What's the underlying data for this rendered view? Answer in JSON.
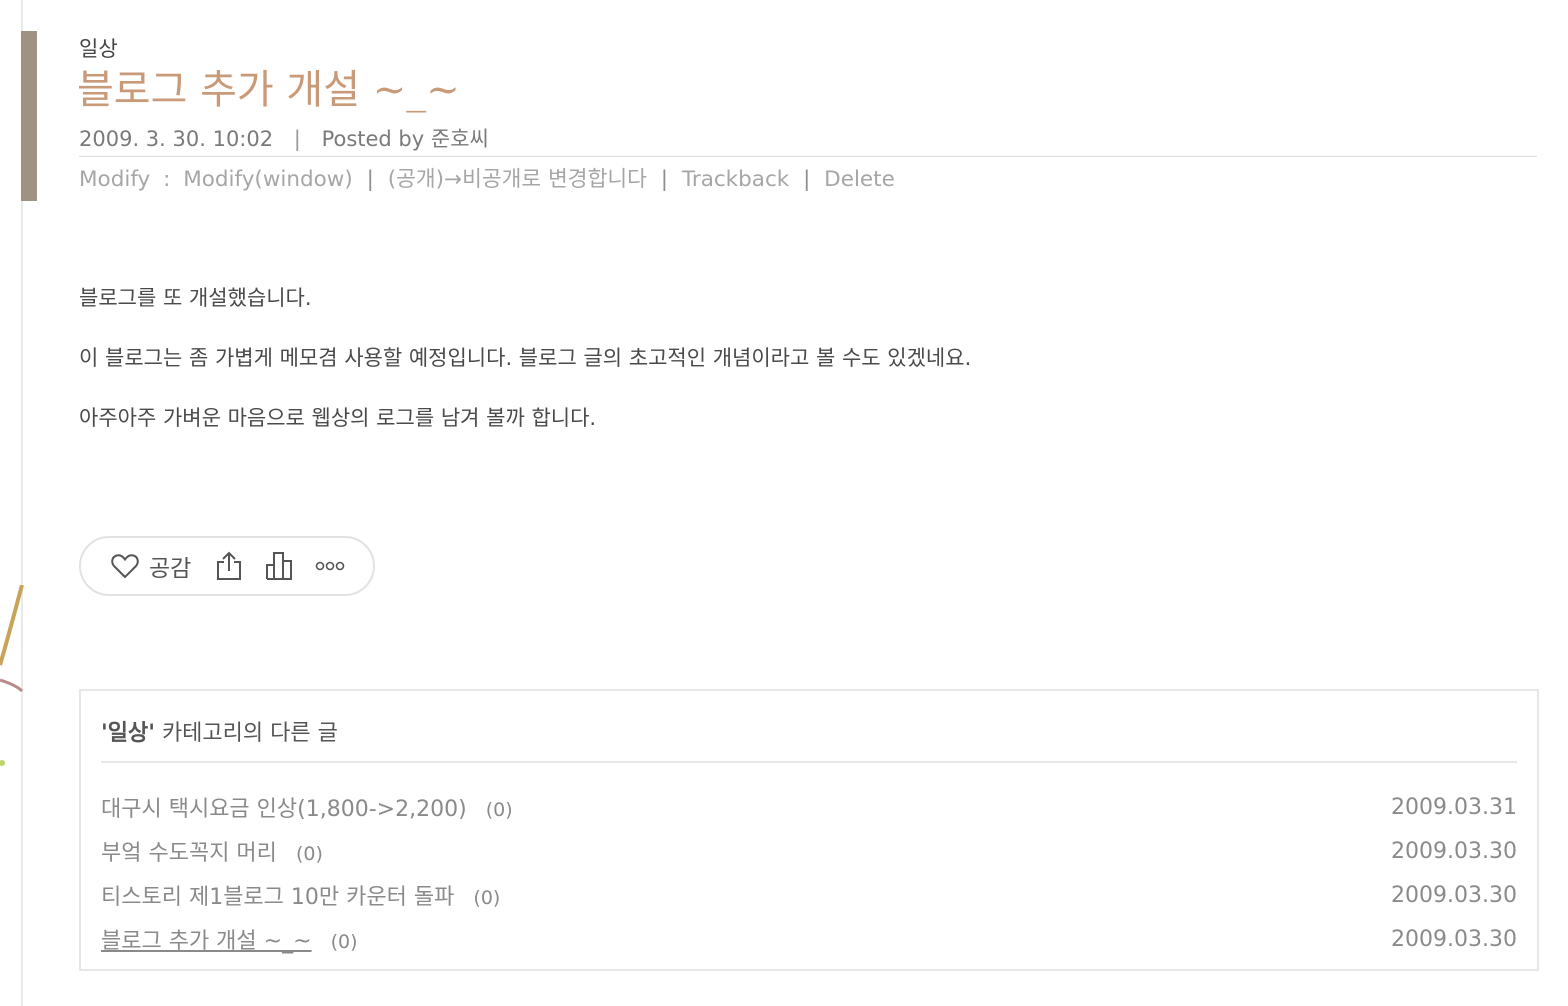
{
  "post": {
    "category": "일상",
    "title": "블로그 추가 개설 ~_~",
    "date": "2009. 3. 30. 10:02",
    "separator": "|",
    "posted_by_label": "Posted by",
    "author": "준호씨",
    "actions": {
      "modify": "Modify",
      "colon": ":",
      "modify_window": "Modify(window)",
      "visibility": "(공개)→비공개로 변경합니다",
      "trackback": "Trackback",
      "delete": "Delete",
      "bar": "|"
    },
    "body": [
      "블로그를 또 개설했습니다.",
      "이 블로그는 좀 가볍게 메모겸 사용할 예정입니다. 블로그 글의 초고적인 개념이라고 볼 수도 있겠네요.",
      "아주아주 가벼운 마음으로 웹상의 로그를 남겨 볼까 합니다."
    ]
  },
  "reactions": {
    "like_label": "공감",
    "icons": [
      "heart-icon",
      "share-icon",
      "stats-icon",
      "more-icon"
    ]
  },
  "related": {
    "title_quoted": "'일상'",
    "title_rest": " 카테고리의 다른 글",
    "items": [
      {
        "title": "대구시 택시요금 인상(1,800->2,200)",
        "count": "(0)",
        "date": "2009.03.31"
      },
      {
        "title": "부엌 수도꼭지 머리",
        "count": "(0)",
        "date": "2009.03.30"
      },
      {
        "title": "티스토리 제1블로그 10만 카운터 돌파",
        "count": "(0)",
        "date": "2009.03.30"
      },
      {
        "title": "블로그 추가 개설 ~_~",
        "count": "(0)",
        "date": "2009.03.30"
      }
    ]
  },
  "colors": {
    "accent_bar": "#a09282",
    "title": "#c99a78"
  }
}
